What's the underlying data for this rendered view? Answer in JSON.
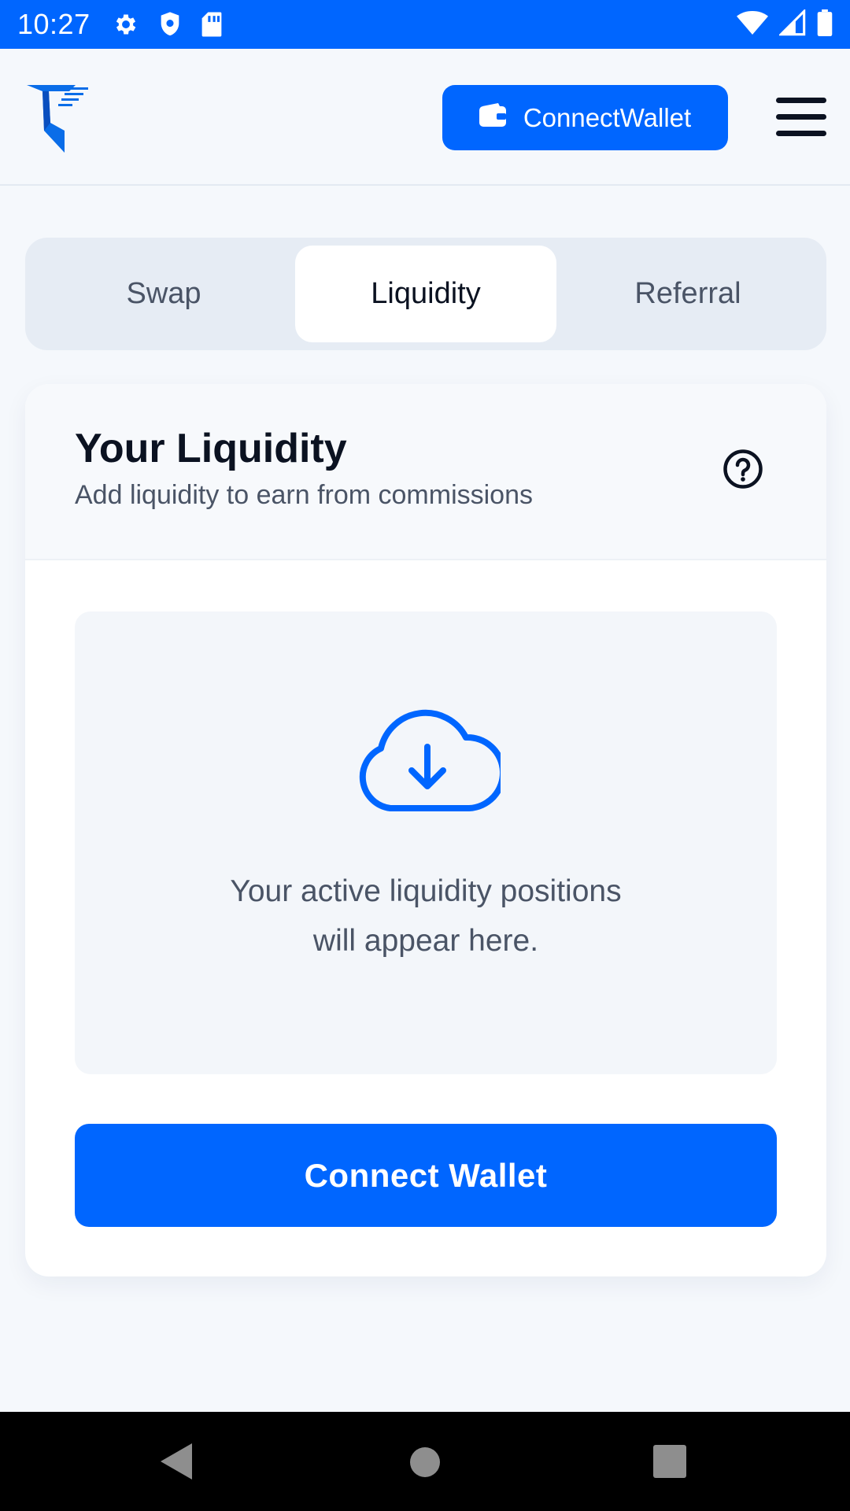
{
  "status_bar": {
    "time": "10:27",
    "left_icons": [
      "gear-icon",
      "shield-icon",
      "sd-card-icon"
    ],
    "right_icons": [
      "wifi-icon",
      "signal-icon",
      "battery-icon"
    ]
  },
  "header": {
    "logo": "brand-logo",
    "connect_wallet_label": "ConnectWallet",
    "menu_icon": "hamburger-menu-icon"
  },
  "tabs": [
    {
      "label": "Swap",
      "active": false
    },
    {
      "label": "Liquidity",
      "active": true
    },
    {
      "label": "Referral",
      "active": false
    }
  ],
  "liquidity_card": {
    "title": "Your Liquidity",
    "subtitle": "Add liquidity to earn from commissions",
    "help_icon": "question-circle-icon",
    "empty_state": {
      "icon": "cloud-download-icon",
      "line1": "Your active liquidity positions",
      "line2": "will appear here."
    },
    "connect_wallet_label": "Connect Wallet"
  },
  "nav_bar": [
    "back-icon",
    "home-icon",
    "recents-icon"
  ],
  "colors": {
    "accent": "#0066ff",
    "background": "#f5f8fc",
    "text_primary": "#0b1221",
    "text_secondary": "#4a5466"
  }
}
